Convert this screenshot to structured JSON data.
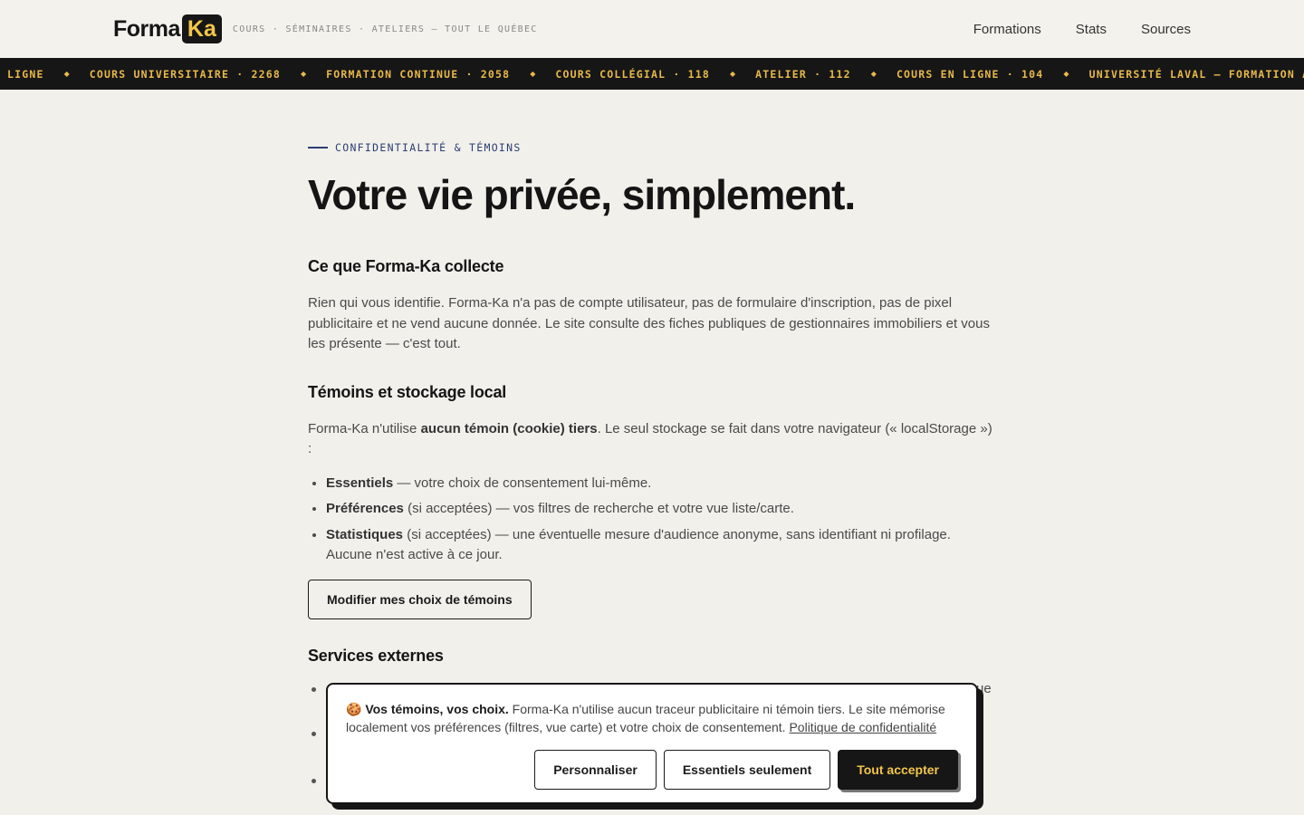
{
  "header": {
    "logo_forma": "Forma",
    "logo_ka": "Ka",
    "tagline": "COURS · SÉMINAIRES · ATELIERS — TOUT LE QUÉBEC",
    "nav": [
      "Formations",
      "Stats",
      "Sources"
    ]
  },
  "ticker": {
    "items": [
      "LIGNE",
      "COURS UNIVERSITAIRE · 2268",
      "FORMATION CONTINUE · 2058",
      "COURS COLLÉGIAL · 118",
      "ATELIER · 112",
      "COURS EN LIGNE · 104",
      "UNIVERSITÉ LAVAL — FORMATION A"
    ],
    "separator": "◆"
  },
  "main": {
    "eyebrow": "CONFIDENTIALITÉ & TÉMOINS",
    "title": "Votre vie privée, simplement.",
    "section1": {
      "heading": "Ce que Forma-Ka collecte",
      "body": "Rien qui vous identifie. Forma-Ka n'a pas de compte utilisateur, pas de formulaire d'inscription, pas de pixel publicitaire et ne vend aucune donnée. Le site consulte des fiches publiques de gestionnaires immobiliers et vous les présente — c'est tout."
    },
    "section2": {
      "heading": "Témoins et stockage local",
      "body_pre": "Forma-Ka n'utilise ",
      "body_bold": "aucun témoin (cookie) tiers",
      "body_post": ". Le seul stockage se fait dans votre navigateur (« localStorage ») :",
      "items": [
        {
          "bold": "Essentiels",
          "text": " — votre choix de consentement lui-même."
        },
        {
          "bold": "Préférences",
          "text": " (si acceptées) — vos filtres de recherche et votre vue liste/carte."
        },
        {
          "bold": "Statistiques",
          "text": " (si acceptées) — une éventuelle mesure d'audience anonyme, sans identifiant ni profilage. Aucune n'est active à ce jour."
        }
      ],
      "button": "Modifier mes choix de témoins"
    },
    "section3": {
      "heading": "Services externes",
      "peek": "ue"
    }
  },
  "cookie_banner": {
    "icon": "cookie-icon",
    "emoji": "🍪",
    "title": "Vos témoins, vos choix.",
    "text": " Forma-Ka n'utilise aucun traceur publicitaire ni témoin tiers. Le site mémorise localement vos préférences (filtres, vue carte) et votre choix de consentement. ",
    "link": "Politique de confidentialité",
    "buttons": {
      "customize": "Personnaliser",
      "essentials": "Essentiels seulement",
      "accept_all": "Tout accepter"
    }
  },
  "colors": {
    "background": "#f2f0eb",
    "dark": "#161616",
    "accent": "#f2c54b",
    "eyebrow": "#2b3e73"
  }
}
